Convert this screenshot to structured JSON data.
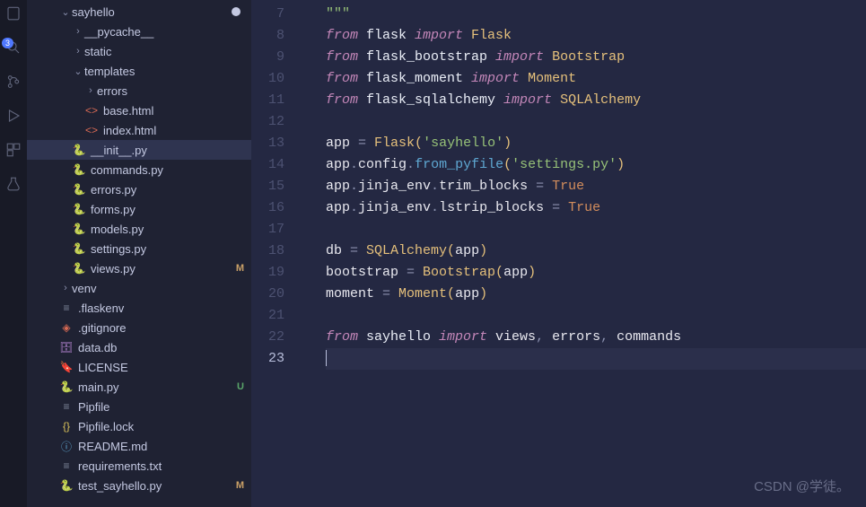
{
  "activity": {
    "badge": "3"
  },
  "tree": [
    {
      "type": "dir",
      "open": true,
      "depth": 0,
      "icon": "chev",
      "name": "sayhello",
      "modDot": true
    },
    {
      "type": "dir",
      "open": false,
      "depth": 1,
      "icon": "chev",
      "name": "__pycache__"
    },
    {
      "type": "dir",
      "open": false,
      "depth": 1,
      "icon": "chev",
      "name": "static"
    },
    {
      "type": "dir",
      "open": true,
      "depth": 1,
      "icon": "chev",
      "name": "templates"
    },
    {
      "type": "dir",
      "open": false,
      "depth": 2,
      "icon": "chev",
      "name": "errors"
    },
    {
      "type": "file",
      "depth": 2,
      "iconCls": "ic-html",
      "iconTxt": "<>",
      "name": "base.html"
    },
    {
      "type": "file",
      "depth": 2,
      "iconCls": "ic-html",
      "iconTxt": "<>",
      "name": "index.html"
    },
    {
      "type": "file",
      "depth": 1,
      "iconCls": "ic-py",
      "iconTxt": "🐍",
      "name": "__init__.py",
      "active": true
    },
    {
      "type": "file",
      "depth": 1,
      "iconCls": "ic-py",
      "iconTxt": "🐍",
      "name": "commands.py"
    },
    {
      "type": "file",
      "depth": 1,
      "iconCls": "ic-py",
      "iconTxt": "🐍",
      "name": "errors.py"
    },
    {
      "type": "file",
      "depth": 1,
      "iconCls": "ic-py",
      "iconTxt": "🐍",
      "name": "forms.py"
    },
    {
      "type": "file",
      "depth": 1,
      "iconCls": "ic-py",
      "iconTxt": "🐍",
      "name": "models.py"
    },
    {
      "type": "file",
      "depth": 1,
      "iconCls": "ic-py",
      "iconTxt": "🐍",
      "name": "settings.py"
    },
    {
      "type": "file",
      "depth": 1,
      "iconCls": "ic-py",
      "iconTxt": "🐍",
      "name": "views.py",
      "status": "M"
    },
    {
      "type": "dir",
      "open": false,
      "depth": 0,
      "icon": "chev",
      "name": "venv"
    },
    {
      "type": "file",
      "depth": 0,
      "iconCls": "ic-yml",
      "iconTxt": "≡",
      "name": ".flaskenv"
    },
    {
      "type": "file",
      "depth": 0,
      "iconCls": "ic-git",
      "iconTxt": "◈",
      "name": ".gitignore"
    },
    {
      "type": "file",
      "depth": 0,
      "iconCls": "ic-db",
      "iconTxt": "🗄",
      "name": "data.db"
    },
    {
      "type": "file",
      "depth": 0,
      "iconCls": "ic-lic",
      "iconTxt": "🔖",
      "name": "LICENSE"
    },
    {
      "type": "file",
      "depth": 0,
      "iconCls": "ic-py",
      "iconTxt": "🐍",
      "name": "main.py",
      "status": "U"
    },
    {
      "type": "file",
      "depth": 0,
      "iconCls": "ic-yml",
      "iconTxt": "≡",
      "name": "Pipfile"
    },
    {
      "type": "file",
      "depth": 0,
      "iconCls": "ic-json",
      "iconTxt": "{}",
      "name": "Pipfile.lock"
    },
    {
      "type": "file",
      "depth": 0,
      "iconCls": "ic-info",
      "iconTxt": "ⓘ",
      "name": "README.md"
    },
    {
      "type": "file",
      "depth": 0,
      "iconCls": "ic-txt",
      "iconTxt": "≡",
      "name": "requirements.txt"
    },
    {
      "type": "file",
      "depth": 0,
      "iconCls": "ic-py",
      "iconTxt": "🐍",
      "name": "test_sayhello.py",
      "status": "M"
    }
  ],
  "code": {
    "startLine": 7,
    "currentLine": 23,
    "lines": [
      [
        {
          "t": "\"\"\"",
          "c": "str"
        }
      ],
      [
        {
          "t": "from ",
          "c": "kw"
        },
        {
          "t": "flask ",
          "c": "mod"
        },
        {
          "t": "import ",
          "c": "kw"
        },
        {
          "t": "Flask",
          "c": "cls"
        }
      ],
      [
        {
          "t": "from ",
          "c": "kw"
        },
        {
          "t": "flask_bootstrap ",
          "c": "mod"
        },
        {
          "t": "import ",
          "c": "kw"
        },
        {
          "t": "Bootstrap",
          "c": "cls"
        }
      ],
      [
        {
          "t": "from ",
          "c": "kw"
        },
        {
          "t": "flask_moment ",
          "c": "mod"
        },
        {
          "t": "import ",
          "c": "kw"
        },
        {
          "t": "Moment",
          "c": "cls"
        }
      ],
      [
        {
          "t": "from ",
          "c": "kw"
        },
        {
          "t": "flask_sqlalchemy ",
          "c": "mod"
        },
        {
          "t": "import ",
          "c": "kw"
        },
        {
          "t": "SQLAlchemy",
          "c": "cls"
        }
      ],
      [],
      [
        {
          "t": "app ",
          "c": "var"
        },
        {
          "t": "= ",
          "c": "punc"
        },
        {
          "t": "Flask",
          "c": "cls"
        },
        {
          "t": "(",
          "c": "paren-y"
        },
        {
          "t": "'sayhello'",
          "c": "str"
        },
        {
          "t": ")",
          "c": "paren-y"
        }
      ],
      [
        {
          "t": "app",
          "c": "var"
        },
        {
          "t": ".",
          "c": "punc"
        },
        {
          "t": "config",
          "c": "var"
        },
        {
          "t": ".",
          "c": "punc"
        },
        {
          "t": "from_pyfile",
          "c": "func"
        },
        {
          "t": "(",
          "c": "paren-y"
        },
        {
          "t": "'settings.py'",
          "c": "str"
        },
        {
          "t": ")",
          "c": "paren-y"
        }
      ],
      [
        {
          "t": "app",
          "c": "var"
        },
        {
          "t": ".",
          "c": "punc"
        },
        {
          "t": "jinja_env",
          "c": "var"
        },
        {
          "t": ".",
          "c": "punc"
        },
        {
          "t": "trim_blocks ",
          "c": "var"
        },
        {
          "t": "= ",
          "c": "punc"
        },
        {
          "t": "True",
          "c": "const"
        }
      ],
      [
        {
          "t": "app",
          "c": "var"
        },
        {
          "t": ".",
          "c": "punc"
        },
        {
          "t": "jinja_env",
          "c": "var"
        },
        {
          "t": ".",
          "c": "punc"
        },
        {
          "t": "lstrip_blocks ",
          "c": "var"
        },
        {
          "t": "= ",
          "c": "punc"
        },
        {
          "t": "True",
          "c": "const"
        }
      ],
      [],
      [
        {
          "t": "db ",
          "c": "var"
        },
        {
          "t": "= ",
          "c": "punc"
        },
        {
          "t": "SQLAlchemy",
          "c": "cls"
        },
        {
          "t": "(",
          "c": "paren-y"
        },
        {
          "t": "app",
          "c": "var"
        },
        {
          "t": ")",
          "c": "paren-y"
        }
      ],
      [
        {
          "t": "bootstrap ",
          "c": "var"
        },
        {
          "t": "= ",
          "c": "punc"
        },
        {
          "t": "Bootstrap",
          "c": "cls"
        },
        {
          "t": "(",
          "c": "paren-y"
        },
        {
          "t": "app",
          "c": "var"
        },
        {
          "t": ")",
          "c": "paren-y"
        }
      ],
      [
        {
          "t": "moment ",
          "c": "var"
        },
        {
          "t": "= ",
          "c": "punc"
        },
        {
          "t": "Moment",
          "c": "cls"
        },
        {
          "t": "(",
          "c": "paren-y"
        },
        {
          "t": "app",
          "c": "var"
        },
        {
          "t": ")",
          "c": "paren-y"
        }
      ],
      [],
      [
        {
          "t": "from ",
          "c": "kw"
        },
        {
          "t": "sayhello ",
          "c": "mod"
        },
        {
          "t": "import ",
          "c": "kw"
        },
        {
          "t": "views",
          "c": "var"
        },
        {
          "t": ", ",
          "c": "punc"
        },
        {
          "t": "errors",
          "c": "var"
        },
        {
          "t": ", ",
          "c": "punc"
        },
        {
          "t": "commands",
          "c": "var"
        }
      ],
      []
    ]
  },
  "watermark": "CSDN @学徒。"
}
